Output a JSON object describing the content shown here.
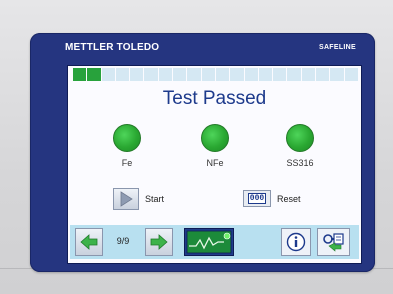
{
  "brand": {
    "left": "METTLER TOLEDO",
    "right": "SAFELINE"
  },
  "progress": {
    "filled_segments": 2,
    "total_segments": 20
  },
  "status": {
    "title": "Test Passed"
  },
  "indicators": [
    {
      "label": "Fe",
      "state": "pass",
      "color": "#2aa832"
    },
    {
      "label": "NFe",
      "state": "pass",
      "color": "#2aa832"
    },
    {
      "label": "SS316",
      "state": "pass",
      "color": "#2aa832"
    }
  ],
  "controls": {
    "start_label": "Start",
    "reset_label": "Reset",
    "reset_icon_text": "000"
  },
  "nav": {
    "counter": "9/9"
  },
  "colors": {
    "bezel": "#253580",
    "title": "#1d3a8c",
    "navbar": "#b8e0f0",
    "pass": "#2aa832"
  }
}
